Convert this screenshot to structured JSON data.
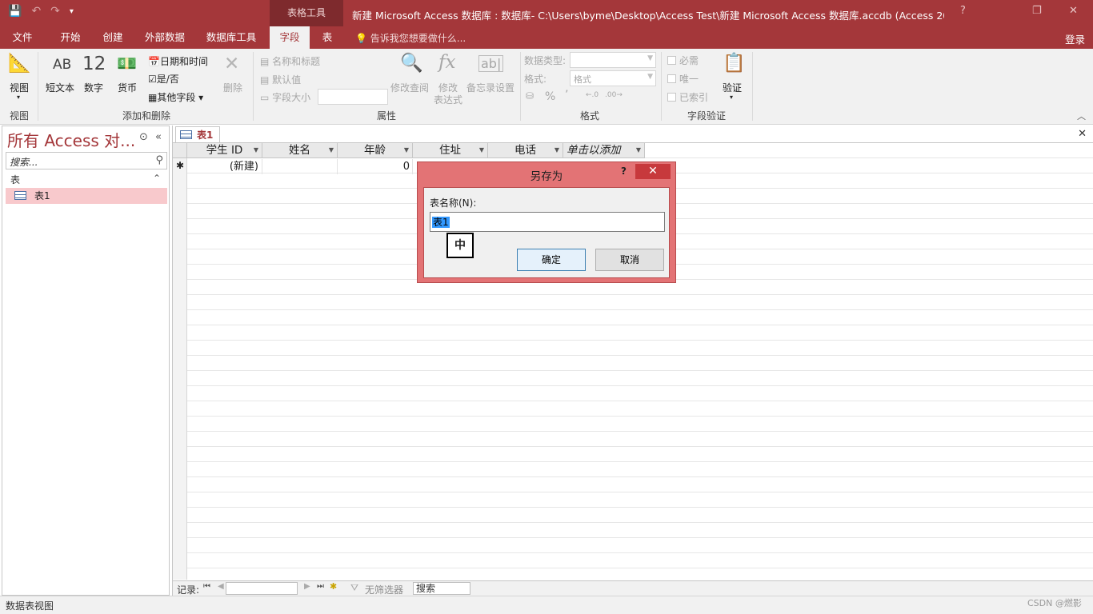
{
  "titlebar": {
    "context_tab": "表格工具",
    "title": "新建 Microsoft Access 数据库 : 数据库- C:\\Users\\byme\\Desktop\\Access Test\\新建 Microsoft Access 数据库.accdb (Access 200...",
    "help": "?",
    "restore": "❐",
    "close": "✕"
  },
  "tabs": [
    "文件",
    "开始",
    "创建",
    "外部数据",
    "数据库工具",
    "字段",
    "表"
  ],
  "active_tab": "字段",
  "tell_me": "告诉我您想要做什么...",
  "login": "登录",
  "ribbon": {
    "view": {
      "label": "视图",
      "group": "视图"
    },
    "add_delete": {
      "group": "添加和删除",
      "short_text": "短文本",
      "short_text_icon": "AB",
      "number": "数字",
      "number_icon": "12",
      "currency": "货币",
      "date_time": "日期和时间",
      "yes_no": "是/否",
      "more_fields": "其他字段",
      "delete": "删除"
    },
    "properties": {
      "group": "属性",
      "name_caption": "名称和标题",
      "default_value": "默认值",
      "field_size": "字段大小",
      "modify_lookups": "修改查阅",
      "modify_expression_1": "修改",
      "modify_expression_2": "表达式",
      "memo_settings": "备忘录设置"
    },
    "formatting": {
      "group": "格式",
      "data_type": "数据类型:",
      "format": "格式:",
      "format_value": "格式",
      "percent": "%",
      "comma": "’",
      "dec_inc": ".00→.0",
      "dec_dec": ".00→.0"
    },
    "validation": {
      "group": "字段验证",
      "required": "必需",
      "unique": "唯一",
      "indexed": "已索引",
      "validate": "验证"
    }
  },
  "nav": {
    "title": "所有 Access 对...",
    "search_placeholder": "搜索...",
    "group": "表",
    "items": [
      {
        "label": "表1"
      }
    ]
  },
  "document": {
    "tab": "表1",
    "columns": [
      "学生 ID",
      "姓名",
      "年龄",
      "住址",
      "电话",
      "单击以添加"
    ],
    "new_row": {
      "id": "(新建)",
      "age": "0"
    },
    "record_bar": {
      "label": "记录:",
      "no_filter": "无筛选器",
      "search": "搜索"
    }
  },
  "dialog": {
    "title": "另存为",
    "help": "?",
    "label": "表名称(N):",
    "value": "表1",
    "ime": "中",
    "ok": "确定",
    "cancel": "取消"
  },
  "status": {
    "left": "数据表视图",
    "watermark": "CSDN @燃影"
  }
}
